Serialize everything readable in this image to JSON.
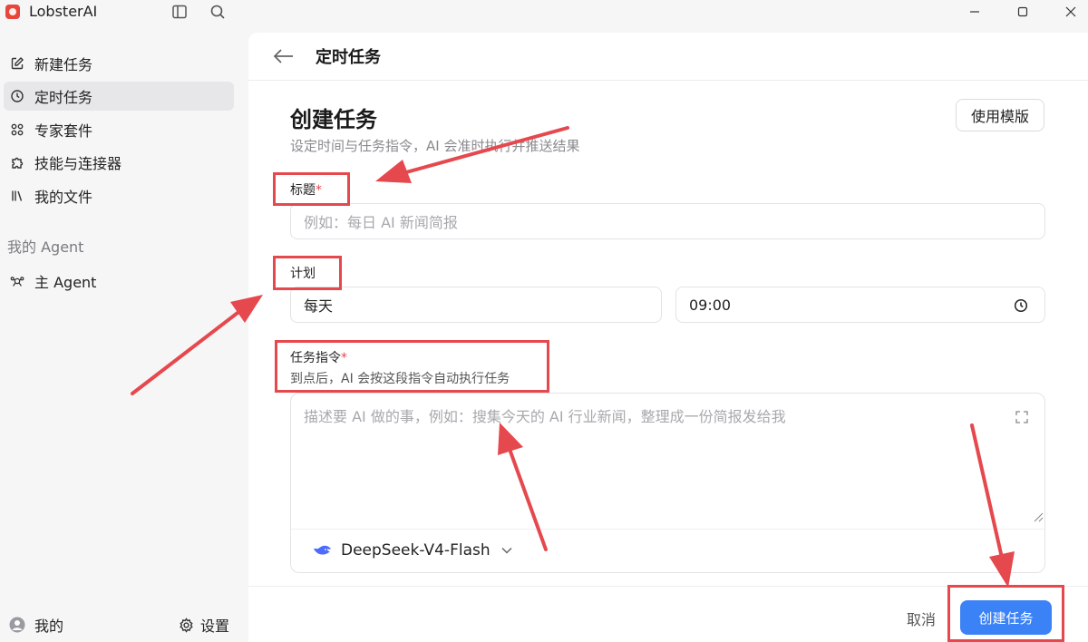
{
  "app": {
    "title": "LobsterAI"
  },
  "sidebar": {
    "items": [
      {
        "label": "新建任务",
        "icon": "edit-icon"
      },
      {
        "label": "定时任务",
        "icon": "clock-icon",
        "active": true
      },
      {
        "label": "专家套件",
        "icon": "grid-icon"
      },
      {
        "label": "技能与连接器",
        "icon": "puzzle-icon"
      },
      {
        "label": "我的文件",
        "icon": "library-icon"
      }
    ],
    "agent_section": "我的 Agent",
    "agent_item": "主 Agent",
    "footer_me": "我的",
    "footer_settings": "设置"
  },
  "header": {
    "title": "定时任务"
  },
  "form": {
    "heading": "创建任务",
    "subtitle": "设定时间与任务指令，AI 会准时执行并推送结果",
    "template_button": "使用模版",
    "title_label": "标题",
    "title_placeholder": "例如：每日 AI 新闻简报",
    "required_mark": "*",
    "schedule_label": "计划",
    "schedule_frequency": "每天",
    "schedule_time": "09:00",
    "instruction_label": "任务指令",
    "instruction_hint": "到点后，AI 会按这段指令自动执行任务",
    "instruction_placeholder": "描述要 AI 做的事，例如：搜集今天的 AI 行业新闻，整理成一份简报发给我",
    "model_name": "DeepSeek-V4-Flash"
  },
  "footer": {
    "cancel": "取消",
    "create": "创建任务"
  },
  "colors": {
    "accent": "#3b82f6",
    "annotation": "#e5484d"
  }
}
